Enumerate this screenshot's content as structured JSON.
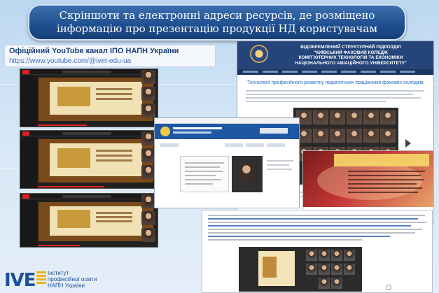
{
  "slide": {
    "title_line1": "Скріншоти та електронні адреси ресурсів, де розміщено",
    "title_line2": "інформацію про презентацію продукції НД користувачам"
  },
  "youtube_caption": {
    "heading": "Офіційний YouTube канал ІПО НАПН України",
    "url": "https://www.youtube.com/@ivet-edu-ua"
  },
  "college_site": {
    "header_line1": "ВІДОКРЕМЛЕНИЙ СТРУКТУРНИЙ ПІДРОЗДІЛ",
    "header_line2": "\"КИЇВСЬКИЙ ФАХОВИЙ КОЛЕДЖ",
    "header_line3": "КОМП`ЮТЕРНИХ ТЕХНОЛОГІЙ ТА ЕКОНОМІКИ",
    "header_line4": "НАЦІОНАЛЬНОГО АВІАЦІЙНОГО УНІВЕРСИТЕТУ\"",
    "article_heading": "Технології професійного розвитку педагогічних працівників фахових коледжів"
  },
  "ministry_site": {
    "header_title": "КИЇВСЬКИЙ ФАХОВИЙ КОЛЕДЖ"
  },
  "logo": {
    "abbr": "IVE",
    "line1": "Інститут",
    "line2": "професійної освіти",
    "line3": "НАПН України",
    "stripe_color": "#f2b21b",
    "brand_color": "#1d4f9a"
  },
  "colors": {
    "banner": "#1e4e8f",
    "youtube_red": "#e02020",
    "college_header": "#25457a"
  }
}
